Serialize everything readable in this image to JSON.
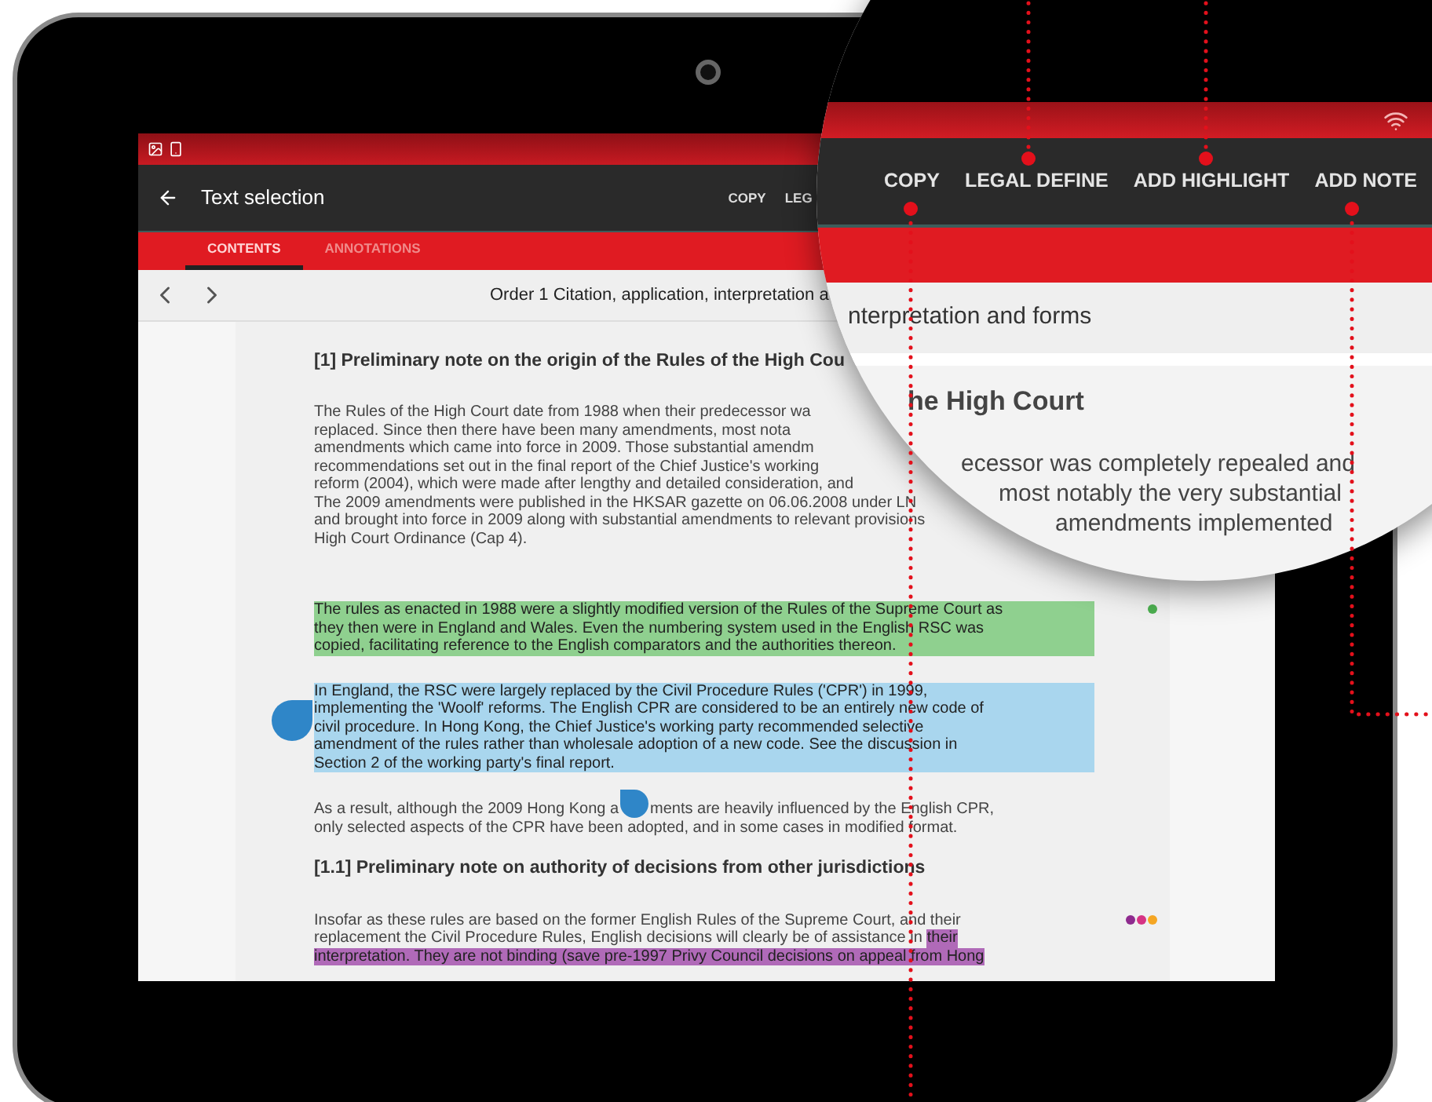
{
  "toolbar": {
    "title": "Text selection",
    "actions": [
      "COPY",
      "LEG"
    ]
  },
  "tabs": [
    {
      "label": "CONTENTS",
      "selected": true
    },
    {
      "label": "ANNOTATIONS",
      "selected": false
    }
  ],
  "nav": {
    "title": "Order 1 Citation, application, interpretation a"
  },
  "document": {
    "heading": "[1] Preliminary note on the origin of the Rules of the High Cou",
    "paragraphs": [
      {
        "lines": [
          [
            "The Rules of the High Court date from 1988 when their predecessor wa"
          ],
          [
            "replaced. Since then there have been many amendments, most nota"
          ],
          [
            "amendments which came into force in 2009. Those substantial amendm"
          ],
          [
            "recommendations set out in the final report of the Chief Justice's working"
          ],
          [
            "reform (2004), which were made after lengthy and detailed consideration, and"
          ],
          [
            "The 2009 amendments were published in the HKSAR gazette on 06.06.2008 under LN"
          ],
          [
            "and brought into force in 2009 along with substantial amendments to relevant provisions"
          ],
          [
            "High Court Ordinance (Cap 4)."
          ]
        ]
      },
      {
        "color": "#8fd08f",
        "marker": [
          {
            "color": "#4caf50"
          }
        ],
        "lines": [
          [
            "The rules as enacted in 1988 were a slightly modified version of the Rules of the Supreme Court as"
          ],
          [
            "they then were in England and Wales. Even the numbering system used in the English RSC was"
          ],
          [
            "copied, facilitating reference to the English comparators and the authorities thereon."
          ]
        ]
      },
      {
        "color": "#a9d6ee",
        "lines": [
          [
            "In England, the RSC were largely replaced by the Civil Procedure Rules ('CPR') in 1999,"
          ],
          [
            "implementing the 'Woolf' reforms. The English CPR are considered to be an entirely new code of"
          ],
          [
            "civil procedure. In Hong Kong, the Chief Justice's working party recommended selective"
          ],
          [
            "amendment of the rules rather than wholesale adoption of a new code. See the discussion in"
          ],
          [
            "Section 2 of the working party's final report."
          ]
        ]
      },
      {
        "lines": [
          [
            "As a result, although the 2009 Hong Kong a",
            "ments are heavily influenced by the English CPR,"
          ],
          [
            "only selected aspects of the CPR have been adopted, and in some cases in modified format."
          ]
        ]
      }
    ],
    "subheading": "[1.1] Preliminary note on authority of decisions from other jurisdictions",
    "last_paragraph": {
      "color": "#b06ab8",
      "marker": [
        {
          "color": "#8e2a8e"
        },
        {
          "color": "#d63384"
        },
        {
          "color": "#f5a623"
        }
      ],
      "lines": [
        [
          {
            "text": "Insofar as these rules are based on the former English Rules of the Supreme Court, and their",
            "highlighted": false
          }
        ],
        [
          {
            "text": "replacement the Civil Procedure Rules, English decisions will clearly be of assistance in",
            "highlighted": false
          },
          {
            "text": "their",
            "highlighted": true
          }
        ],
        [
          {
            "text": "interpretation. They are not binding (save pre-1997 Privy Council decisions on appeal from Hong",
            "highlighted": true
          }
        ]
      ]
    }
  },
  "magnifier": {
    "actions": [
      "COPY",
      "LEGAL DEFINE",
      "ADD HIGHLIGHT",
      "ADD NOTE"
    ],
    "nav_title": "nterpretation and forms",
    "heading": "he High Court",
    "lines": [
      "ecessor was completely repealed and",
      "most notably the very substantial",
      "amendments implemented"
    ]
  }
}
